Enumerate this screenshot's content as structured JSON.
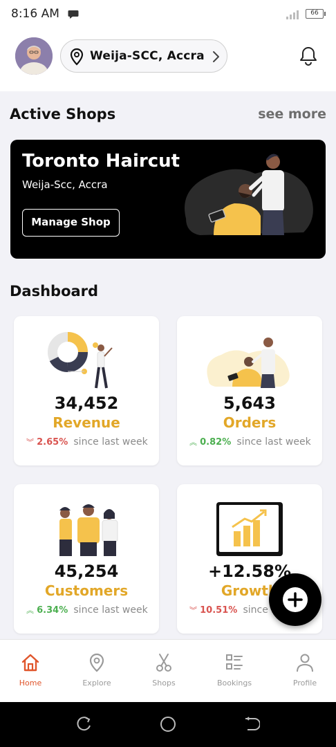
{
  "status_bar": {
    "time": "8:16 AM",
    "battery": "66"
  },
  "header": {
    "location": "Weija-SCC, Accra",
    "icons": {
      "location": "location-pin-icon",
      "chevron": "chevron-right-icon",
      "notifications": "bell-icon"
    }
  },
  "active_shops": {
    "title": "Active Shops",
    "see_more": "see more",
    "shop": {
      "name": "Toronto Haircut",
      "location": "Weija-Scc, Accra",
      "button": "Manage Shop"
    }
  },
  "dashboard": {
    "title": "Dashboard",
    "cards": [
      {
        "value": "34,452",
        "label": "Revenue",
        "trend": "down",
        "change": "2.65%",
        "since": "since last week"
      },
      {
        "value": "5,643",
        "label": "Orders",
        "trend": "up",
        "change": "0.82%",
        "since": "since last week"
      },
      {
        "value": "45,254",
        "label": "Customers",
        "trend": "up",
        "change": "6.34%",
        "since": "since last week"
      },
      {
        "value": "+12.58%",
        "label": "Growth",
        "trend": "down",
        "change": "10.51%",
        "since": "since last week"
      }
    ]
  },
  "bottom_nav": {
    "items": [
      {
        "label": "Home",
        "icon": "home-icon",
        "active": true
      },
      {
        "label": "Explore",
        "icon": "location-pin-icon"
      },
      {
        "label": "Shops",
        "icon": "scissors-icon"
      },
      {
        "label": "Bookings",
        "icon": "list-icon"
      },
      {
        "label": "Profile",
        "icon": "person-icon"
      }
    ]
  },
  "colors": {
    "accent": "#e2a728",
    "active_nav": "#e0552b",
    "down": "#d9534f",
    "up": "#4caf50"
  }
}
